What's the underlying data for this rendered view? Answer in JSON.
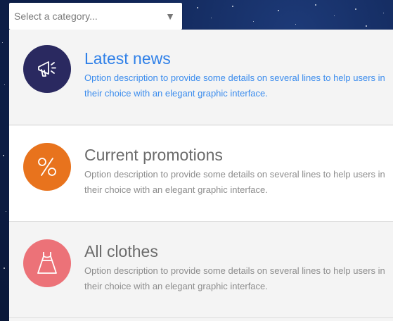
{
  "category_select": {
    "placeholder": "Select a category...",
    "arrow_icon": "dropdown-arrow-icon"
  },
  "options": [
    {
      "title": "Latest news",
      "description": "Option description to provide some details on several lines to help users in their choice with an elegant graphic interface.",
      "icon": "megaphone-icon",
      "color": "#2a2960",
      "selected": true
    },
    {
      "title": "Current promotions",
      "description": "Option description to provide some details on several lines to help users in their choice with an elegant graphic interface.",
      "icon": "percent-icon",
      "color": "#e8731d",
      "selected": false
    },
    {
      "title": "All clothes",
      "description": "Option description to provide some details on several lines to help users in their choice with an elegant graphic interface.",
      "icon": "dress-icon",
      "color": "#ec7278",
      "selected": false
    }
  ],
  "colors": {
    "accent": "#2f80e8",
    "panel_bg": "#f4f4f4"
  }
}
